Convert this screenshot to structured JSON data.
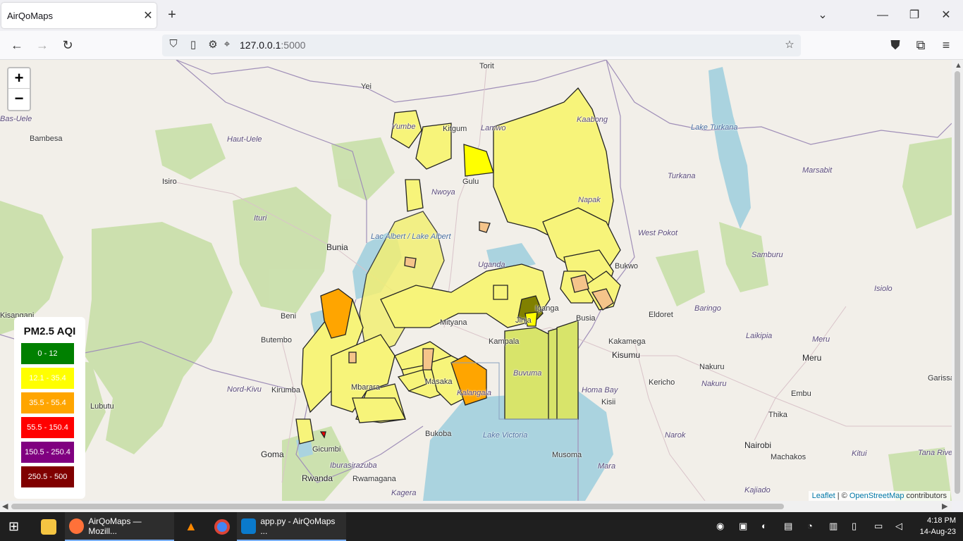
{
  "browser": {
    "tab_title": "AirQoMaps",
    "url_host": "127.0.0.1",
    "url_port": ":5000"
  },
  "map": {
    "zoom_in": "+",
    "zoom_out": "−",
    "attribution_leaflet": "Leaflet",
    "attribution_sep": " | © ",
    "attribution_osm": "OpenStreetMap",
    "attribution_tail": " contributors",
    "place_labels": [
      {
        "key": "torit",
        "text": "Torit"
      },
      {
        "key": "yei",
        "text": "Yei"
      },
      {
        "key": "bas_uele",
        "text": "Bas-Uele"
      },
      {
        "key": "bambesa",
        "text": "Bambesa"
      },
      {
        "key": "haut_uele",
        "text": "Haut-Uele"
      },
      {
        "key": "isiro",
        "text": "Isiro"
      },
      {
        "key": "yumbe",
        "text": "Yumbe"
      },
      {
        "key": "kitgum",
        "text": "Kitgum"
      },
      {
        "key": "lamwo",
        "text": "Lamwo"
      },
      {
        "key": "kaabong",
        "text": "Kaabong"
      },
      {
        "key": "gulu",
        "text": "Gulu"
      },
      {
        "key": "nwoya",
        "text": "Nwoya"
      },
      {
        "key": "napak",
        "text": "Napak"
      },
      {
        "key": "ituri",
        "text": "Ituri"
      },
      {
        "key": "bunia",
        "text": "Bunia"
      },
      {
        "key": "lake_albert",
        "text": "Lac Albert / Lake Albert"
      },
      {
        "key": "uganda",
        "text": "Uganda"
      },
      {
        "key": "beni",
        "text": "Beni"
      },
      {
        "key": "butembo",
        "text": "Butembo"
      },
      {
        "key": "nord_kivu",
        "text": "Nord-Kivu"
      },
      {
        "key": "kirumba",
        "text": "Kirumba"
      },
      {
        "key": "lubutu",
        "text": "Lubutu"
      },
      {
        "key": "kisangani",
        "text": "Kisangani"
      },
      {
        "key": "goma",
        "text": "Goma"
      },
      {
        "key": "gicumbi",
        "text": "Gicumbi"
      },
      {
        "key": "rwanda",
        "text": "Rwanda"
      },
      {
        "key": "rwamagana",
        "text": "Rwamagana"
      },
      {
        "key": "iburasirazuba",
        "text": "Iburasirazuba"
      },
      {
        "key": "kagera",
        "text": "Kagera"
      },
      {
        "key": "bukoba",
        "text": "Bukoba"
      },
      {
        "key": "lake_victoria",
        "text": "Lake Victoria"
      },
      {
        "key": "musoma",
        "text": "Musoma"
      },
      {
        "key": "mara",
        "text": "Mara"
      },
      {
        "key": "kalangala",
        "text": "Kalangala"
      },
      {
        "key": "buvuma",
        "text": "Buvuma"
      },
      {
        "key": "masaka",
        "text": "Masaka"
      },
      {
        "key": "mbarara",
        "text": "Mbarara"
      },
      {
        "key": "mityana",
        "text": "Mityana"
      },
      {
        "key": "kampala",
        "text": "Kampala"
      },
      {
        "key": "jinja",
        "text": "Jinja"
      },
      {
        "key": "iganga",
        "text": "Iganga"
      },
      {
        "key": "busia",
        "text": "Busia"
      },
      {
        "key": "bukwo",
        "text": "Bukwo"
      },
      {
        "key": "west_pokot",
        "text": "West Pokot"
      },
      {
        "key": "turkana",
        "text": "Turkana"
      },
      {
        "key": "lake_turkana",
        "text": "Lake Turkana"
      },
      {
        "key": "marsabit",
        "text": "Marsabit"
      },
      {
        "key": "samburu",
        "text": "Samburu"
      },
      {
        "key": "isiolo",
        "text": "Isiolo"
      },
      {
        "key": "baringo",
        "text": "Baringo"
      },
      {
        "key": "eldoret",
        "text": "Eldoret"
      },
      {
        "key": "kakamega",
        "text": "Kakamega"
      },
      {
        "key": "kisumu",
        "text": "Kisumu"
      },
      {
        "key": "homa_bay",
        "text": "Homa Bay"
      },
      {
        "key": "kisii",
        "text": "Kisii"
      },
      {
        "key": "kericho",
        "text": "Kericho"
      },
      {
        "key": "nakuru_city",
        "text": "Nakuru"
      },
      {
        "key": "nakuru",
        "text": "Nakuru"
      },
      {
        "key": "laikipia",
        "text": "Laikipia"
      },
      {
        "key": "meru_co",
        "text": "Meru"
      },
      {
        "key": "meru",
        "text": "Meru"
      },
      {
        "key": "embu",
        "text": "Embu"
      },
      {
        "key": "thika",
        "text": "Thika"
      },
      {
        "key": "nairobi",
        "text": "Nairobi"
      },
      {
        "key": "machakos",
        "text": "Machakos"
      },
      {
        "key": "narok",
        "text": "Narok"
      },
      {
        "key": "kajiado",
        "text": "Kajiado"
      },
      {
        "key": "kitui",
        "text": "Kitui"
      },
      {
        "key": "garissa",
        "text": "Garissa"
      },
      {
        "key": "tana_river",
        "text": "Tana River"
      }
    ]
  },
  "legend": {
    "title": "PM2.5 AQI",
    "items": [
      {
        "label": "0 - 12",
        "color": "#008000"
      },
      {
        "label": "12.1 - 35.4",
        "color": "#ffff00"
      },
      {
        "label": "35.5 - 55.4",
        "color": "#ffa500"
      },
      {
        "label": "55.5 - 150.4",
        "color": "#ff0000"
      },
      {
        "label": "150.5 - 250.4",
        "color": "#800080"
      },
      {
        "label": "250.5 - 500",
        "color": "#800000"
      }
    ]
  },
  "taskbar": {
    "firefox_label": "AirQoMaps — Mozill...",
    "vscode_label": "app.py - AirQoMaps ...",
    "time": "4:18 PM",
    "date": "14-Aug-23"
  }
}
